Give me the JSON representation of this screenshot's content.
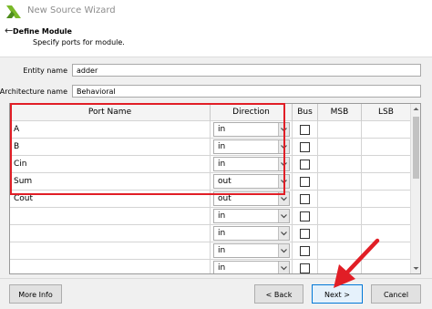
{
  "window": {
    "title": "New Source Wizard",
    "logo_icon": "xilinx-logo-icon",
    "accent_color": "#7ab929"
  },
  "header": {
    "back_icon": "back-arrow-icon",
    "title": "Define Module",
    "subtitle": "Specify ports for module."
  },
  "form": {
    "entity_label": "Entity name",
    "entity_value": "adder",
    "arch_label": "Architecture name",
    "arch_value": "Behavioral"
  },
  "port_table": {
    "columns": [
      "Port Name",
      "Direction",
      "Bus",
      "MSB",
      "LSB"
    ],
    "rows": [
      {
        "name": "A",
        "direction": "in",
        "bus": false,
        "msb": "",
        "lsb": ""
      },
      {
        "name": "B",
        "direction": "in",
        "bus": false,
        "msb": "",
        "lsb": ""
      },
      {
        "name": "Cin",
        "direction": "in",
        "bus": false,
        "msb": "",
        "lsb": ""
      },
      {
        "name": "Sum",
        "direction": "out",
        "bus": false,
        "msb": "",
        "lsb": ""
      },
      {
        "name": "Cout",
        "direction": "out",
        "bus": false,
        "msb": "",
        "lsb": ""
      },
      {
        "name": "",
        "direction": "in",
        "bus": false,
        "msb": "",
        "lsb": ""
      },
      {
        "name": "",
        "direction": "in",
        "bus": false,
        "msb": "",
        "lsb": ""
      },
      {
        "name": "",
        "direction": "in",
        "bus": false,
        "msb": "",
        "lsb": ""
      },
      {
        "name": "",
        "direction": "in",
        "bus": false,
        "msb": "",
        "lsb": ""
      }
    ]
  },
  "annotation": {
    "highlight_color": "#e11e26"
  },
  "footer": {
    "more_info": "More Info",
    "back": "< Back",
    "next": "Next >",
    "cancel": "Cancel"
  }
}
